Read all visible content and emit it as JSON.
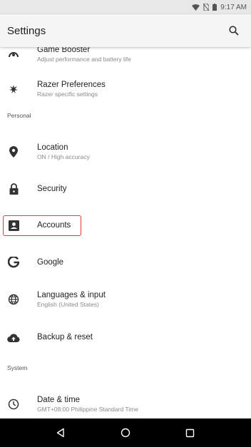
{
  "status_bar": {
    "time": "9:17 AM",
    "icons": [
      "wifi-icon",
      "no-sim-icon",
      "battery-icon"
    ]
  },
  "app_bar": {
    "title": "Settings",
    "search_icon": "search-icon"
  },
  "items": [
    {
      "title": "Game Booster",
      "summary": "Adjust performance and battery life",
      "icon": "game-booster-icon"
    },
    {
      "title": "Razer Preferences",
      "summary": "Razer specific settings",
      "icon": "razer-icon"
    },
    {
      "title": "Location",
      "summary": "ON / High accuracy",
      "icon": "location-pin-icon"
    },
    {
      "title": "Security",
      "summary": "",
      "icon": "lock-icon"
    },
    {
      "title": "Accounts",
      "summary": "",
      "icon": "account-box-icon"
    },
    {
      "title": "Google",
      "summary": "",
      "icon": "google-g-icon"
    },
    {
      "title": "Languages & input",
      "summary": "English (United States)",
      "icon": "globe-icon"
    },
    {
      "title": "Backup & reset",
      "summary": "",
      "icon": "cloud-upload-icon"
    },
    {
      "title": "Date & time",
      "summary": "GMT+08:00 Philippine Standard Time",
      "icon": "clock-icon"
    }
  ],
  "sections": {
    "personal": "Personal",
    "system": "System"
  },
  "nav_bar": {
    "icons": [
      "back-icon",
      "home-icon",
      "recents-icon"
    ]
  },
  "colors": {
    "highlight": "#e53935",
    "nav_bar": "#000000",
    "status_bar": "#e8e8e8"
  }
}
